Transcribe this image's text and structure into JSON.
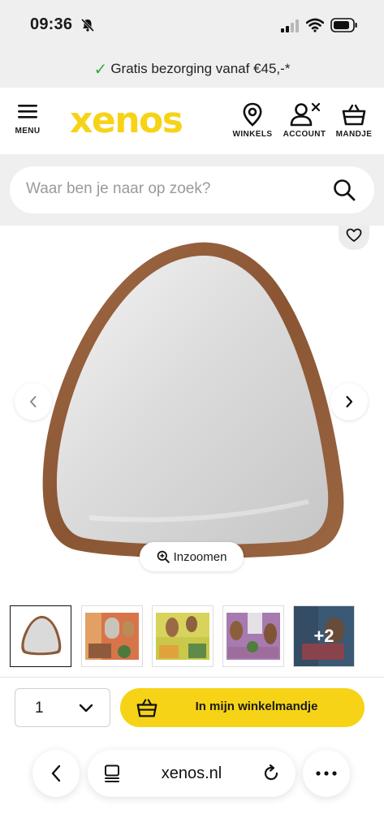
{
  "status_bar": {
    "time": "09:36"
  },
  "promo": {
    "check": "✓",
    "text": "Gratis bezorging vanaf €45,-*"
  },
  "header": {
    "menu_label": "MENU",
    "logo_text": "xenos",
    "stores_label": "WINKELS",
    "account_label": "ACCOUNT",
    "cart_label": "MANDJE",
    "brand_color": "#F6D316"
  },
  "search": {
    "placeholder": "Waar ben je naar op zoek?"
  },
  "gallery": {
    "zoom_label": "Inzoomen",
    "thumbnails_more": "+2"
  },
  "purchase": {
    "quantity": "1",
    "add_to_cart_label": "In mijn winkelmandje"
  },
  "browser": {
    "url": "xenos.nl"
  }
}
